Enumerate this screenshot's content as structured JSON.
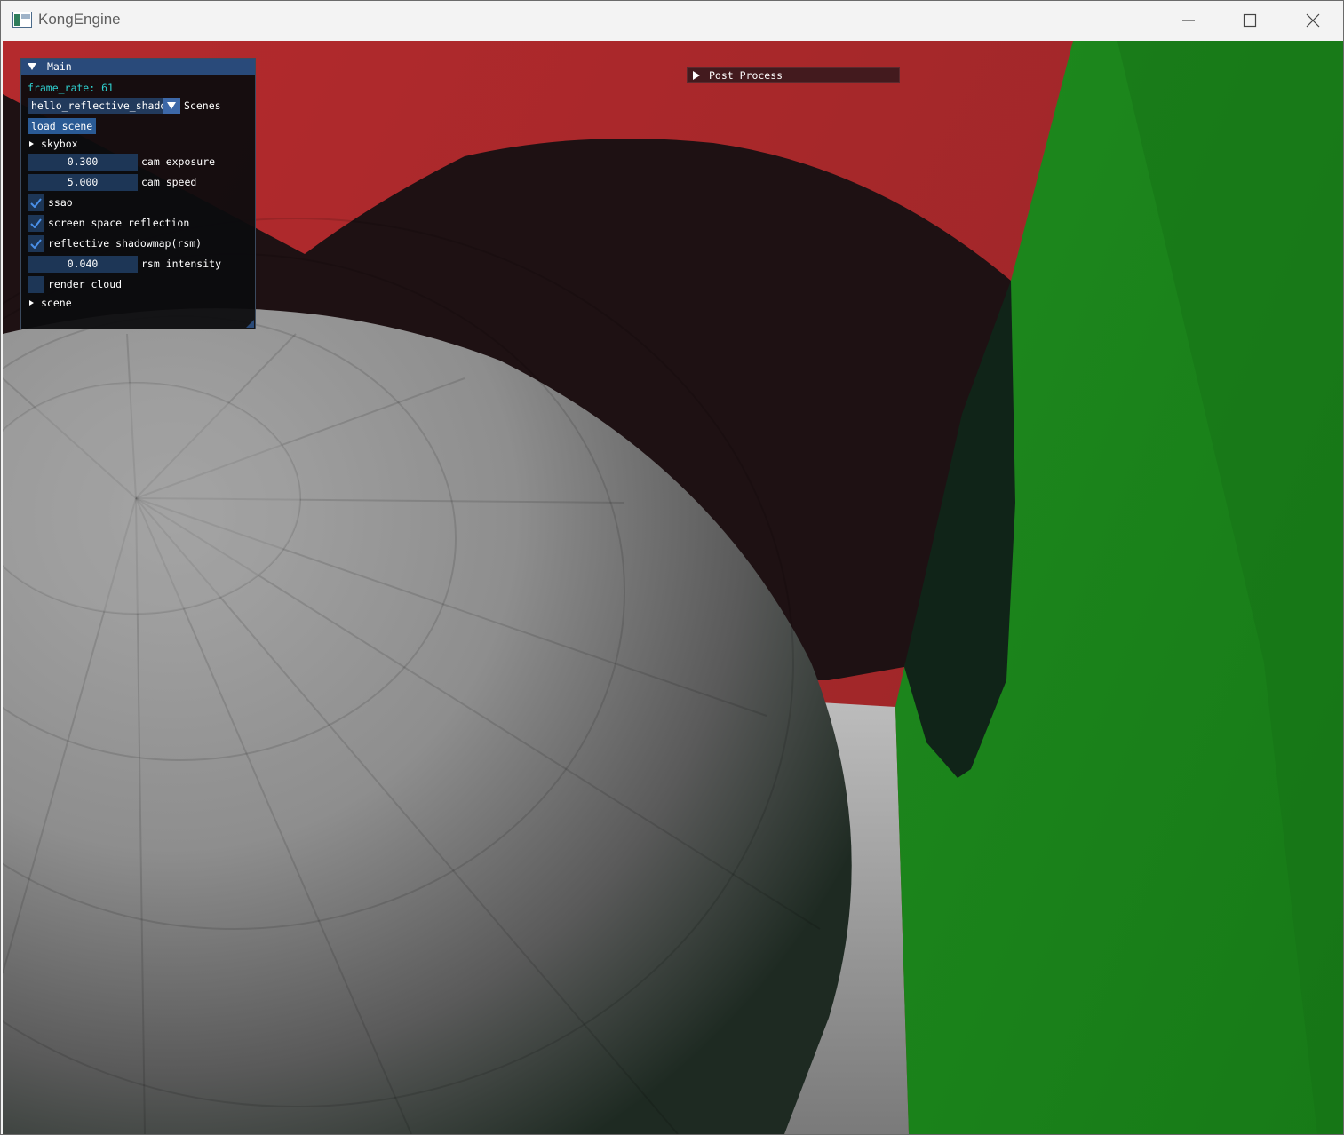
{
  "window": {
    "title": "KongEngine",
    "icon": "app-window-icon"
  },
  "main_panel": {
    "title": "Main",
    "frame_rate_text": "frame_rate: 61",
    "scene_combo_value": "hello_reflective_shadowmap",
    "scene_combo_label": "Scenes",
    "load_scene_label": "load scene",
    "skybox_label": "skybox",
    "cam_exposure": {
      "value": "0.300",
      "label": "cam exposure"
    },
    "cam_speed": {
      "value": "5.000",
      "label": "cam speed"
    },
    "ssao": {
      "label": "ssao",
      "checked": true
    },
    "ssr": {
      "label": "screen space reflection",
      "checked": true
    },
    "rsm": {
      "label": "reflective shadowmap(rsm)",
      "checked": true
    },
    "rsm_intensity": {
      "value": "0.040",
      "label": "rsm intensity"
    },
    "render_cloud": {
      "label": "render cloud",
      "checked": false
    },
    "scene_label": "scene"
  },
  "post_process_panel": {
    "title": "Post Process"
  },
  "colors": {
    "red_wall": "#a8292b",
    "green_wall": "#1a8a1a",
    "panel_title": "#294a7a",
    "fps_text": "#2fd0d0"
  }
}
